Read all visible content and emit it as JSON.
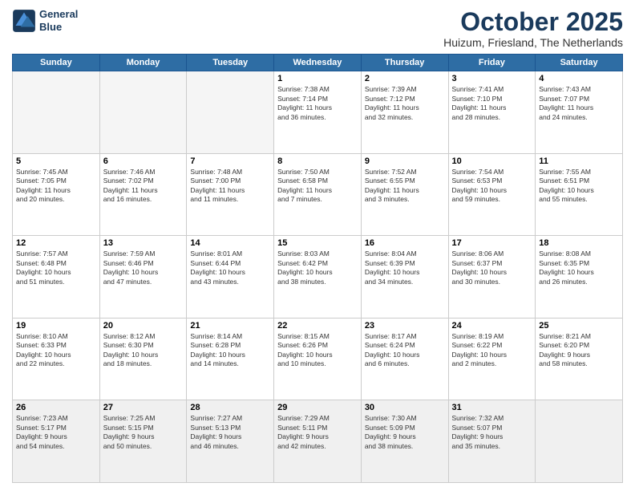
{
  "logo": {
    "line1": "General",
    "line2": "Blue"
  },
  "title": "October 2025",
  "subtitle": "Huizum, Friesland, The Netherlands",
  "headers": [
    "Sunday",
    "Monday",
    "Tuesday",
    "Wednesday",
    "Thursday",
    "Friday",
    "Saturday"
  ],
  "weeks": [
    [
      {
        "day": "",
        "info": ""
      },
      {
        "day": "",
        "info": ""
      },
      {
        "day": "",
        "info": ""
      },
      {
        "day": "1",
        "info": "Sunrise: 7:38 AM\nSunset: 7:14 PM\nDaylight: 11 hours\nand 36 minutes."
      },
      {
        "day": "2",
        "info": "Sunrise: 7:39 AM\nSunset: 7:12 PM\nDaylight: 11 hours\nand 32 minutes."
      },
      {
        "day": "3",
        "info": "Sunrise: 7:41 AM\nSunset: 7:10 PM\nDaylight: 11 hours\nand 28 minutes."
      },
      {
        "day": "4",
        "info": "Sunrise: 7:43 AM\nSunset: 7:07 PM\nDaylight: 11 hours\nand 24 minutes."
      }
    ],
    [
      {
        "day": "5",
        "info": "Sunrise: 7:45 AM\nSunset: 7:05 PM\nDaylight: 11 hours\nand 20 minutes."
      },
      {
        "day": "6",
        "info": "Sunrise: 7:46 AM\nSunset: 7:02 PM\nDaylight: 11 hours\nand 16 minutes."
      },
      {
        "day": "7",
        "info": "Sunrise: 7:48 AM\nSunset: 7:00 PM\nDaylight: 11 hours\nand 11 minutes."
      },
      {
        "day": "8",
        "info": "Sunrise: 7:50 AM\nSunset: 6:58 PM\nDaylight: 11 hours\nand 7 minutes."
      },
      {
        "day": "9",
        "info": "Sunrise: 7:52 AM\nSunset: 6:55 PM\nDaylight: 11 hours\nand 3 minutes."
      },
      {
        "day": "10",
        "info": "Sunrise: 7:54 AM\nSunset: 6:53 PM\nDaylight: 10 hours\nand 59 minutes."
      },
      {
        "day": "11",
        "info": "Sunrise: 7:55 AM\nSunset: 6:51 PM\nDaylight: 10 hours\nand 55 minutes."
      }
    ],
    [
      {
        "day": "12",
        "info": "Sunrise: 7:57 AM\nSunset: 6:48 PM\nDaylight: 10 hours\nand 51 minutes."
      },
      {
        "day": "13",
        "info": "Sunrise: 7:59 AM\nSunset: 6:46 PM\nDaylight: 10 hours\nand 47 minutes."
      },
      {
        "day": "14",
        "info": "Sunrise: 8:01 AM\nSunset: 6:44 PM\nDaylight: 10 hours\nand 43 minutes."
      },
      {
        "day": "15",
        "info": "Sunrise: 8:03 AM\nSunset: 6:42 PM\nDaylight: 10 hours\nand 38 minutes."
      },
      {
        "day": "16",
        "info": "Sunrise: 8:04 AM\nSunset: 6:39 PM\nDaylight: 10 hours\nand 34 minutes."
      },
      {
        "day": "17",
        "info": "Sunrise: 8:06 AM\nSunset: 6:37 PM\nDaylight: 10 hours\nand 30 minutes."
      },
      {
        "day": "18",
        "info": "Sunrise: 8:08 AM\nSunset: 6:35 PM\nDaylight: 10 hours\nand 26 minutes."
      }
    ],
    [
      {
        "day": "19",
        "info": "Sunrise: 8:10 AM\nSunset: 6:33 PM\nDaylight: 10 hours\nand 22 minutes."
      },
      {
        "day": "20",
        "info": "Sunrise: 8:12 AM\nSunset: 6:30 PM\nDaylight: 10 hours\nand 18 minutes."
      },
      {
        "day": "21",
        "info": "Sunrise: 8:14 AM\nSunset: 6:28 PM\nDaylight: 10 hours\nand 14 minutes."
      },
      {
        "day": "22",
        "info": "Sunrise: 8:15 AM\nSunset: 6:26 PM\nDaylight: 10 hours\nand 10 minutes."
      },
      {
        "day": "23",
        "info": "Sunrise: 8:17 AM\nSunset: 6:24 PM\nDaylight: 10 hours\nand 6 minutes."
      },
      {
        "day": "24",
        "info": "Sunrise: 8:19 AM\nSunset: 6:22 PM\nDaylight: 10 hours\nand 2 minutes."
      },
      {
        "day": "25",
        "info": "Sunrise: 8:21 AM\nSunset: 6:20 PM\nDaylight: 9 hours\nand 58 minutes."
      }
    ],
    [
      {
        "day": "26",
        "info": "Sunrise: 7:23 AM\nSunset: 5:17 PM\nDaylight: 9 hours\nand 54 minutes."
      },
      {
        "day": "27",
        "info": "Sunrise: 7:25 AM\nSunset: 5:15 PM\nDaylight: 9 hours\nand 50 minutes."
      },
      {
        "day": "28",
        "info": "Sunrise: 7:27 AM\nSunset: 5:13 PM\nDaylight: 9 hours\nand 46 minutes."
      },
      {
        "day": "29",
        "info": "Sunrise: 7:29 AM\nSunset: 5:11 PM\nDaylight: 9 hours\nand 42 minutes."
      },
      {
        "day": "30",
        "info": "Sunrise: 7:30 AM\nSunset: 5:09 PM\nDaylight: 9 hours\nand 38 minutes."
      },
      {
        "day": "31",
        "info": "Sunrise: 7:32 AM\nSunset: 5:07 PM\nDaylight: 9 hours\nand 35 minutes."
      },
      {
        "day": "",
        "info": ""
      }
    ]
  ]
}
